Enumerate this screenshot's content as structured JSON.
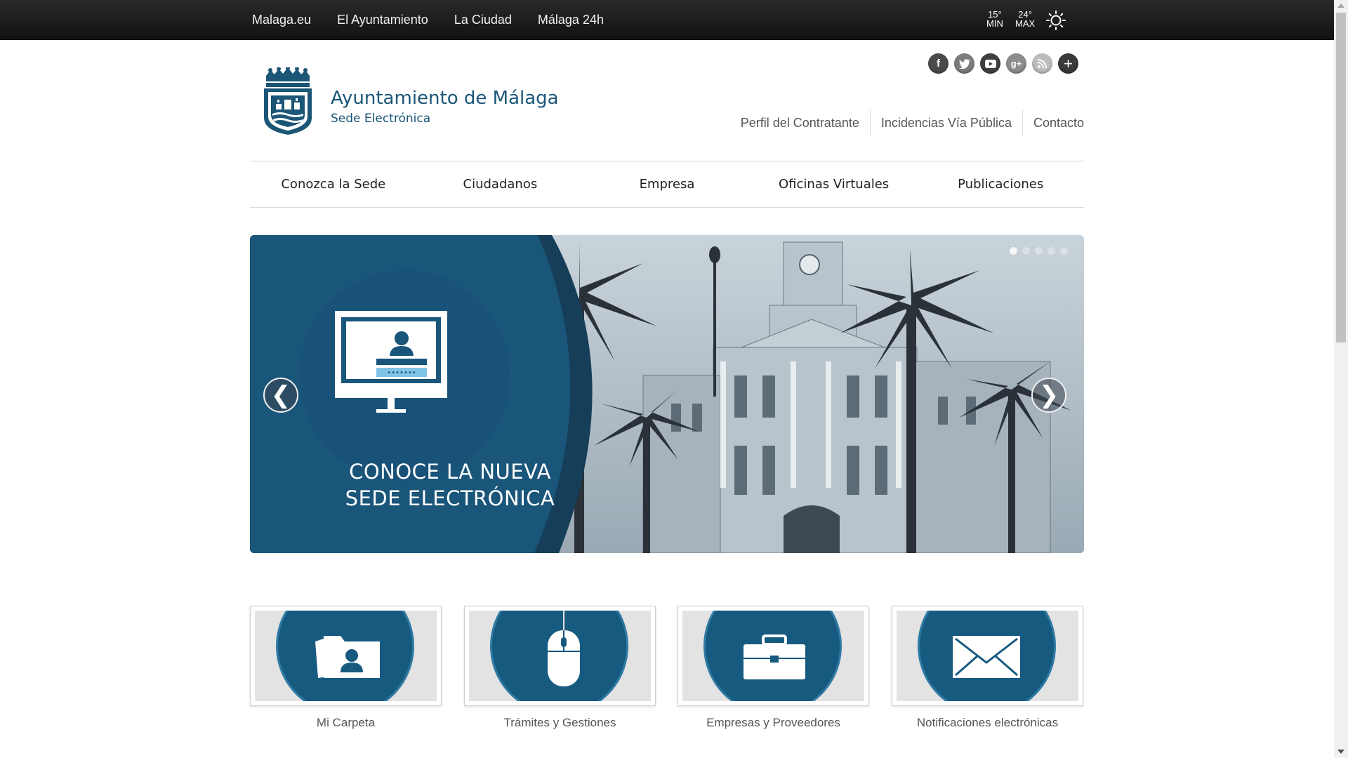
{
  "topbar": {
    "links": [
      "Malaga.eu",
      "El Ayuntamiento",
      "La Ciudad",
      "Málaga 24h"
    ],
    "weather": {
      "min_value": "15°",
      "min_label": "MIN",
      "max_value": "24°",
      "max_label": "MAX",
      "icon": "sun-icon"
    }
  },
  "header": {
    "title": "Ayuntamiento de Málaga",
    "subtitle": "Sede Electrónica",
    "social": [
      "facebook-icon",
      "twitter-icon",
      "youtube-icon",
      "google-plus-icon",
      "rss-icon",
      "plus-icon"
    ],
    "utility_links": [
      "Perfil del Contratante",
      "Incidencias Vía Pública",
      "Contacto"
    ]
  },
  "main_nav": [
    "Conozca la Sede",
    "Ciudadanos",
    "Empresa",
    "Oficinas Virtuales",
    "Publicaciones"
  ],
  "slider": {
    "line1": "CONOCE LA NUEVA",
    "line2": "SEDE ELECTRÓNICA",
    "prev": "❮",
    "next": "❯",
    "active_dot": 1,
    "dot_count": 5
  },
  "cards": [
    {
      "label": "Mi Carpeta",
      "icon": "folder-user-icon"
    },
    {
      "label": "Trámites y Gestiones",
      "icon": "mouse-icon"
    },
    {
      "label": "Empresas y Proveedores",
      "icon": "briefcase-icon"
    },
    {
      "label": "Notificaciones electrónicas",
      "icon": "envelope-icon"
    }
  ],
  "colors": {
    "brand": "#1b5677",
    "slide_blue": "#175a80",
    "topbar": "#1a1a1a"
  }
}
